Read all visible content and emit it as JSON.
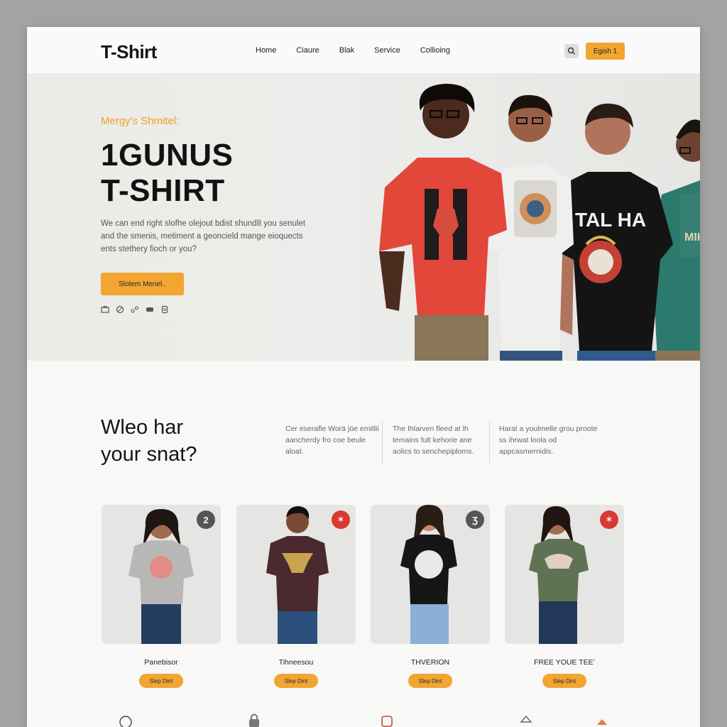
{
  "header": {
    "logo": "T-Shirt",
    "nav": [
      "Home",
      "Ciaure",
      "Blak",
      "Service",
      "Collioing"
    ],
    "cta_label": "Egish 1"
  },
  "hero": {
    "eyebrow": "Mergy's Shmitel:",
    "title_line1": "1GUNUS",
    "title_line2": "T-SHIRT",
    "description": "We can end right slofhe olejout bdist shund8 you senulet and the smenis, metiment a geoncield mange eioquects ents stethery fioch or you?",
    "button_label": "Slotem Menel..",
    "shirt_graphics": [
      "TAL HA",
      "MIKOSD"
    ],
    "social_icons": [
      "briefcase-icon",
      "globe-icon",
      "share-icon",
      "chat-icon",
      "device-icon"
    ]
  },
  "middle": {
    "title_line1": "Wleo har",
    "title_line2": "your snat?",
    "columns": [
      "Cer eserafle Worä jöe emitlii aancherdy fro coe beule aloat.",
      "The Ihlarven fleed at lh temains fult kehorie ane aolics to senchepiploms.",
      "Harat a youlmelle grou proote ss ihrwat loola od appcasmernidis."
    ]
  },
  "products": [
    {
      "name": "Panebisor",
      "button": "Slep Dint",
      "badge": "2",
      "badge_color": "#555555",
      "shirt_color": "#b7b8b5",
      "graphic_color": "#e38b86"
    },
    {
      "name": "Tihneesou",
      "button": "Slep Dint",
      "badge": "✶",
      "badge_color": "#d83a32",
      "shirt_color": "#4a2a2e",
      "graphic_color": "#c9a450"
    },
    {
      "name": "THVERION",
      "button": "Slep Dint",
      "badge": "Ʒ",
      "badge_color": "#555555",
      "shirt_color": "#161616",
      "graphic_color": "#e9e9e9"
    },
    {
      "name": "FREE YOUE TEE’",
      "button": "Slep Dint",
      "badge": "✶",
      "badge_color": "#d83a32",
      "shirt_color": "#5f7354",
      "graphic_color": "#e3cfc2"
    }
  ],
  "footer_icons": [
    "basket-icon",
    "lock-icon",
    "bag-icon",
    "tag-icon",
    "arrow-icon"
  ],
  "colors": {
    "accent": "#f2a531",
    "badge_red": "#d83a32",
    "eyebrow": "#f0a02a"
  }
}
